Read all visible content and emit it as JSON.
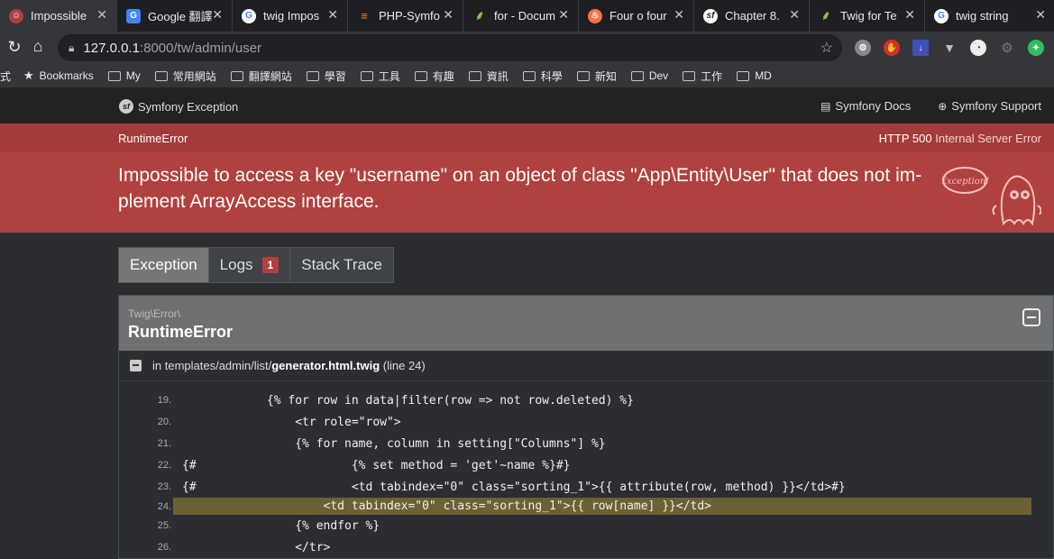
{
  "browser": {
    "tabs": [
      {
        "title": "Impossible",
        "favicon": "symfony-ghost-icon",
        "color": "#b0413e",
        "active": true
      },
      {
        "title": "Google 翻譯",
        "favicon": "google-translate-icon",
        "color": "#4285f4"
      },
      {
        "title": "twig Impos",
        "favicon": "google-icon",
        "color": "#ffffff"
      },
      {
        "title": "PHP-Symfo",
        "favicon": "stackoverflow-icon",
        "color": "#f48024"
      },
      {
        "title": "for - Docum",
        "favicon": "twig-icon",
        "color": "#8bc34a"
      },
      {
        "title": "Four o four",
        "favicon": "fire-icon",
        "color": "#ff7043"
      },
      {
        "title": "Chapter 8.",
        "favicon": "symfony-icon",
        "color": "#ffffff"
      },
      {
        "title": "Twig for Te",
        "favicon": "twig-icon",
        "color": "#8bc34a"
      },
      {
        "title": "twig string",
        "favicon": "google-icon",
        "color": "#ffffff"
      }
    ],
    "url_host": "127.0.0.1",
    "url_path": ":8000/tw/admin/user",
    "bookmarks_label": "Bookmarks",
    "bookmark_prefix": "式",
    "bookmark_folders": [
      "My",
      "常用網站",
      "翻譯網站",
      "學習",
      "工具",
      "有趣",
      "資訊",
      "科學",
      "新知",
      "Dev",
      "工作",
      "MD"
    ]
  },
  "symfony": {
    "brand": "Symfony Exception",
    "docs": "Symfony Docs",
    "support": "Symfony Support",
    "exception_class": "RuntimeError",
    "http_code": "HTTP 500",
    "http_text": "Internal Server Error",
    "message": "Impossible to access a key \"username\" on an object of class \"App\\Entity\\User\" that does not im-plement ArrayAccess interface.",
    "ghost_label": "Exception!",
    "tabs": {
      "exception": "Exception",
      "logs": "Logs",
      "logs_count": "1",
      "stack": "Stack Trace"
    },
    "trace": {
      "namespace": "Twig\\Error\\",
      "name": "RuntimeError",
      "file_prefix": "in templates/admin/list/",
      "file_name": "generator.html.twig",
      "file_line": "(line 24)"
    },
    "code_lines": [
      {
        "num": "19.",
        "text": "            {% for row in data|filter(row => not row.deleted) %}"
      },
      {
        "num": "20.",
        "text": "                <tr role=\"row\">"
      },
      {
        "num": "21.",
        "text": "                {% for name, column in setting[\"Columns\"] %}"
      },
      {
        "num": "22.",
        "text": "{#                      {% set method = 'get'~name %}#}"
      },
      {
        "num": "23.",
        "text": "{#                      <td tabindex=\"0\" class=\"sorting_1\">{{ attribute(row, method) }}</td>#}"
      },
      {
        "num": "24.",
        "text": "                    <td tabindex=\"0\" class=\"sorting_1\">{{ row[name] }}</td>"
      },
      {
        "num": "25.",
        "text": "                {% endfor %}"
      },
      {
        "num": "26.",
        "text": "                </tr>"
      }
    ]
  }
}
